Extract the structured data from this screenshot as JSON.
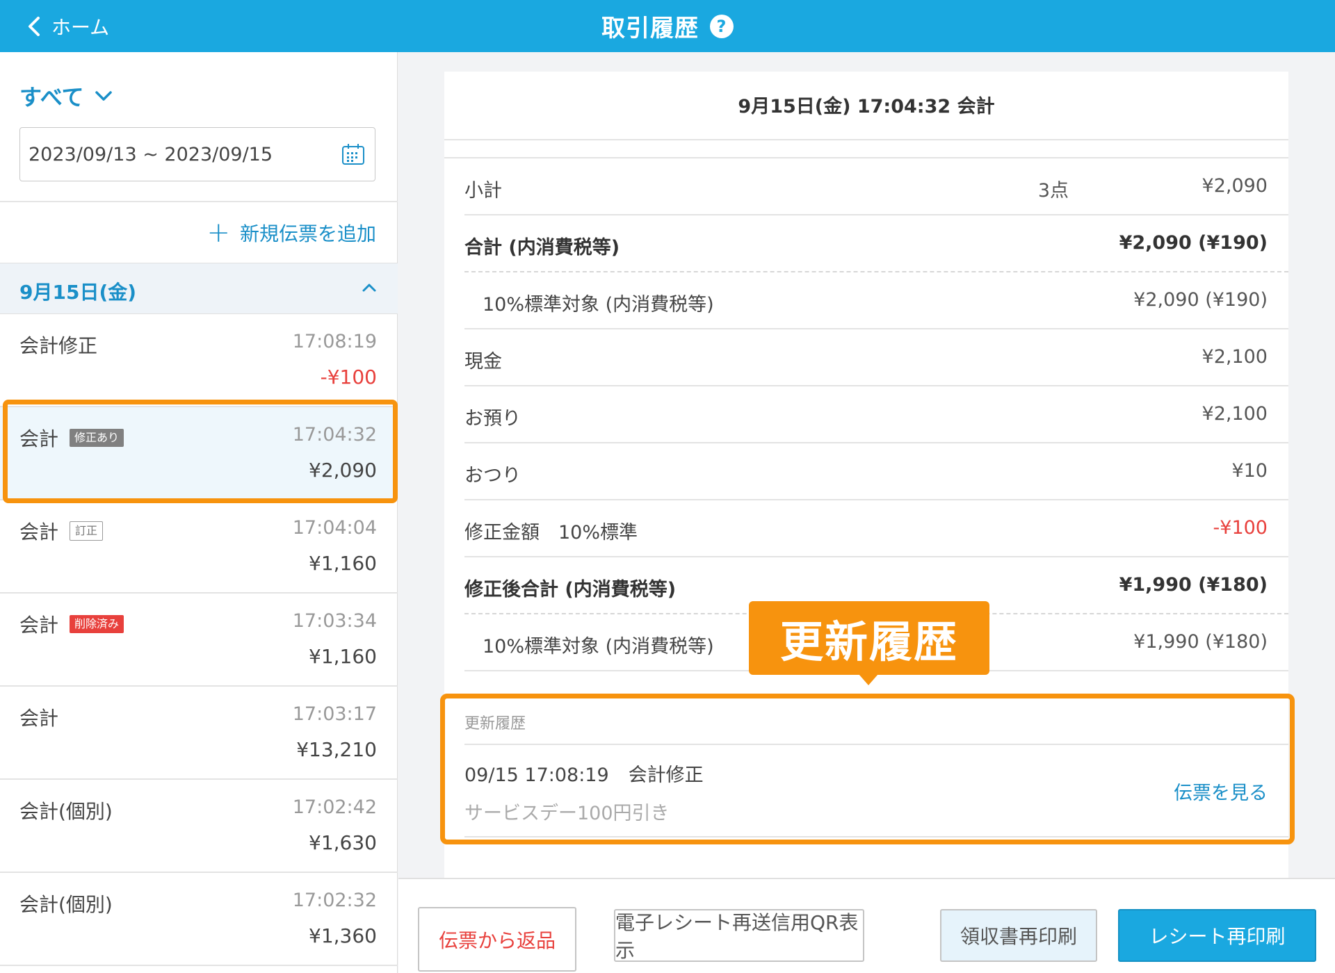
{
  "header": {
    "back_label": "ホーム",
    "title": "取引履歴",
    "help_glyph": "?"
  },
  "sidebar": {
    "filter_label": "すべて",
    "date_range": "2023/09/13 ~ 2023/09/15",
    "add_slip_label": "新規伝票を追加",
    "day_label": "9月15日(金)",
    "transactions": [
      {
        "name": "会計修正",
        "badge": "",
        "time": "17:08:19",
        "amount": "-¥100"
      },
      {
        "name": "会計",
        "badge": "修正あり",
        "time": "17:04:32",
        "amount": "¥2,090"
      },
      {
        "name": "会計",
        "badge": "訂正",
        "time": "17:04:04",
        "amount": "¥1,160"
      },
      {
        "name": "会計",
        "badge": "削除済み",
        "time": "17:03:34",
        "amount": "¥1,160"
      },
      {
        "name": "会計",
        "badge": "",
        "time": "17:03:17",
        "amount": "¥13,210"
      },
      {
        "name": "会計(個別)",
        "badge": "",
        "time": "17:02:42",
        "amount": "¥1,630"
      },
      {
        "name": "会計(個別)",
        "badge": "",
        "time": "17:02:32",
        "amount": "¥1,360"
      }
    ]
  },
  "detail": {
    "title": "9月15日(金) 17:04:32 会計",
    "rows": {
      "subtotal": {
        "label": "小計",
        "count": "3点",
        "value": "¥2,090"
      },
      "total": {
        "label": "合計 (内消費税等)",
        "value": "¥2,090 (¥190)"
      },
      "total_tax": {
        "label": "10%標準対象 (内消費税等)",
        "value": "¥2,090 (¥190)"
      },
      "cash": {
        "label": "現金",
        "value": "¥2,100"
      },
      "received": {
        "label": "お預り",
        "value": "¥2,100"
      },
      "change": {
        "label": "おつり",
        "value": "¥10"
      },
      "correction": {
        "label": "修正金額　10%標準",
        "value": "-¥100"
      },
      "corrected_total": {
        "label": "修正後合計 (内消費税等)",
        "value": "¥1,990 (¥180)"
      },
      "corrected_tax": {
        "label": "10%標準対象 (内消費税等)",
        "value": "¥1,990 (¥180)"
      }
    },
    "history": {
      "heading": "更新履歴",
      "entry_time": "09/15 17:08:19",
      "entry_kind": "会計修正",
      "entry_note": "サービスデー100円引き",
      "view_link": "伝票を見る"
    },
    "callout": "更新履歴"
  },
  "footer": {
    "return_label": "伝票から返品",
    "qr_label": "電子レシート再送信用QR表示",
    "receipt_label": "領収書再印刷",
    "reprint_label": "レシート再印刷"
  },
  "colors": {
    "brand": "#1aa8e0",
    "accent_text": "#1a8fc8",
    "highlight": "#f7930e",
    "negative": "#e8403c"
  }
}
